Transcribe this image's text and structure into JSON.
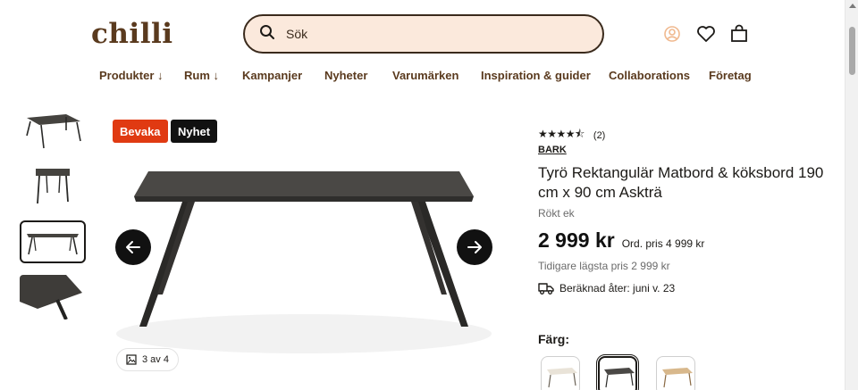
{
  "header": {
    "logo_text": "chilli",
    "search": {
      "placeholder": "Sök",
      "value": ""
    },
    "icons": [
      "account-icon",
      "heart-icon",
      "bag-icon"
    ]
  },
  "nav": {
    "items": [
      {
        "label": "Produkter ↓"
      },
      {
        "label": "Rum ↓"
      },
      {
        "label": "Kampanjer"
      },
      {
        "label": "Nyheter"
      },
      {
        "label": "Varumärken"
      },
      {
        "label": "Inspiration & guider"
      },
      {
        "label": "Collaborations"
      },
      {
        "label": "Företag"
      }
    ]
  },
  "gallery": {
    "thumbnails": [
      {
        "name": "table-angled"
      },
      {
        "name": "table-end"
      },
      {
        "name": "table-front",
        "selected": true
      },
      {
        "name": "table-detail"
      }
    ],
    "badges": [
      {
        "label": "Bevaka",
        "color": "#e03a12"
      },
      {
        "label": "Nyhet",
        "color": "#111111"
      }
    ],
    "counter": "3 av 4"
  },
  "product": {
    "rating": {
      "stars": 4.5,
      "count": "(2)"
    },
    "brand": "BARK",
    "title": "Tyrö Rektangulär Matbord & köksbord 190 cm x 90 cm Askträ",
    "variant": "Rökt ek",
    "price": "2 999 kr",
    "ordinary_price": "Ord. pris 4 999 kr",
    "lowest_price": "Tidigare lägsta pris 2 999 kr",
    "delivery": "Beräknad åter: juni v. 23",
    "color_label": "Färg:",
    "swatches": [
      {
        "name": "white-oak"
      },
      {
        "name": "smoked-oak",
        "selected": true
      },
      {
        "name": "natural-oak"
      }
    ]
  },
  "colors": {
    "brand": "#5a3a1e",
    "search_bg": "#fbe9dc",
    "badge_red": "#e03a12",
    "table_dark": "#3b3a37"
  }
}
